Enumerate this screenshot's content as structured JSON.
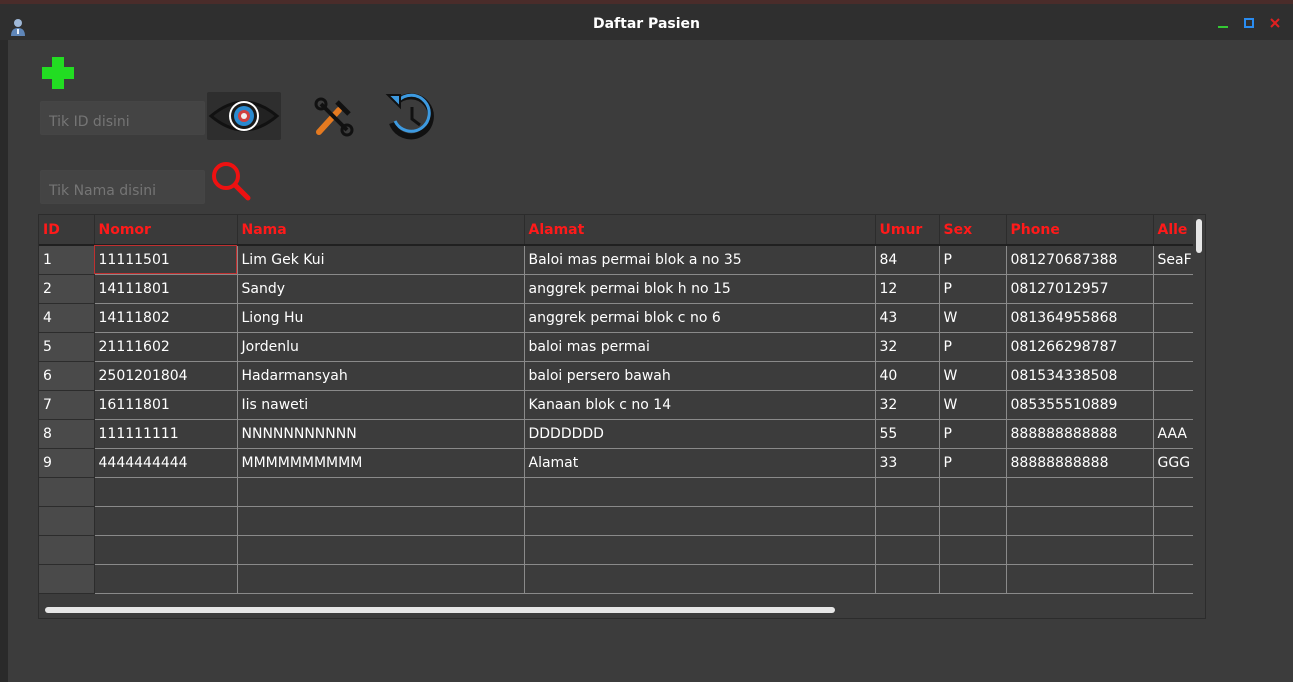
{
  "window": {
    "title": "Daftar Pasien",
    "controls": {
      "minimize": "minimize-icon",
      "maximize": "maximize-icon",
      "close": "close-icon"
    },
    "colors": {
      "minimize": "#34c934",
      "maximize": "#2a8cf0",
      "close": "#e02020"
    }
  },
  "toolbar": {
    "add_icon": "plus-icon",
    "id_placeholder": "Tik ID disini",
    "nama_placeholder": "Tik Nama disini",
    "view_icon": "eye-icon",
    "tools_icon": "tools-icon",
    "history_icon": "history-icon",
    "search_icon": "search-icon"
  },
  "table": {
    "header_color": "#ff1a1a",
    "columns": [
      "ID",
      "Nomor",
      "Nama",
      "Alamat",
      "Umur",
      "Sex",
      "Phone",
      "Alle"
    ],
    "rows": [
      [
        "1",
        "11111501",
        "Lim Gek Kui",
        "Baloi mas permai blok a no 35",
        "84",
        "P",
        "081270687388",
        "SeaF"
      ],
      [
        "2",
        "14111801",
        "Sandy",
        "anggrek permai blok h no 15",
        "12",
        "P",
        "08127012957",
        ""
      ],
      [
        "4",
        "14111802",
        "Liong Hu",
        "anggrek permai blok c no 6",
        "43",
        "W",
        "081364955868",
        ""
      ],
      [
        "5",
        "21111602",
        "Jordenlu",
        "baloi mas permai",
        "32",
        "P",
        "081266298787",
        ""
      ],
      [
        "6",
        "2501201804",
        "Hadarmansyah",
        "baloi persero bawah",
        "40",
        "W",
        "081534338508",
        ""
      ],
      [
        "7",
        "16111801",
        "Iis naweti",
        "Kanaan blok c no 14",
        "32",
        "W",
        "085355510889",
        ""
      ],
      [
        "8",
        "111111111",
        "NNNNNNNNNNN",
        "DDDDDDD",
        "55",
        "P",
        "888888888888",
        "AAA"
      ],
      [
        "9",
        "4444444444",
        "MMMMMMMMMM",
        "Alamat",
        "33",
        "P",
        "88888888888",
        "GGG"
      ],
      [
        "",
        "",
        "",
        "",
        "",
        "",
        "",
        ""
      ],
      [
        "",
        "",
        "",
        "",
        "",
        "",
        "",
        ""
      ],
      [
        "",
        "",
        "",
        "",
        "",
        "",
        "",
        ""
      ],
      [
        "",
        "",
        "",
        "",
        "",
        "",
        "",
        ""
      ]
    ]
  }
}
